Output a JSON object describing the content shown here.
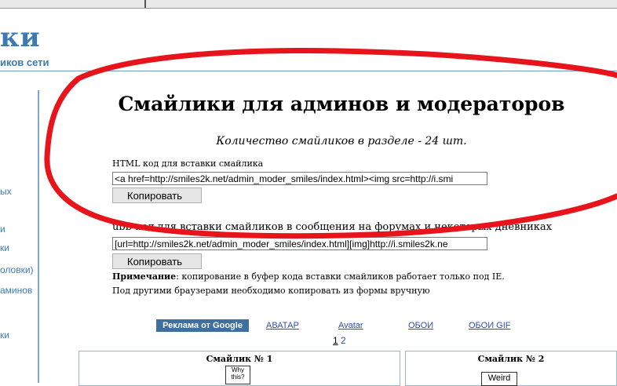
{
  "header": {
    "logo_fragment": "ки",
    "tagline_fragment": "иков сети"
  },
  "sidebar": {
    "items": [
      "ых",
      "и",
      "ки",
      "оловки)",
      "аминов",
      "ки"
    ]
  },
  "main": {
    "title": "Смайлики для админов и модераторов",
    "count_line": "Количество смайликов в разделе - 24 шт.",
    "html_label": "HTML код для вставки смайлика",
    "html_code": "<a href=http://smiles2k.net/admin_moder_smiles/index.html><img src=http://i.smi",
    "copy_button": "Копировать",
    "ubb_label": "ubb-код для вставки смайликов в сообщения на форумах и некоторых дневниках",
    "ubb_code": "[url=http://smiles2k.net/admin_moder_smiles/index.html][img]http://i.smiles2k.ne",
    "note_bold": "Примечание",
    "note_rest": ": копирование в буфер кода вставки смайликов работает только под IE.",
    "note_line2": "Под другими браузерами необходимо копировать из формы вручную"
  },
  "ads": {
    "google_label": "Реклама от Google",
    "links": [
      "АВАТАР",
      "Avatar",
      "ОБОИ",
      "ОБОИ GIF"
    ]
  },
  "pager": {
    "current": "1",
    "other": "2"
  },
  "smiles": [
    {
      "title": "Смайлик № 1",
      "sign_text": "Why this?"
    },
    {
      "title": "Смайлик № 2",
      "sign_text": "Weird"
    }
  ],
  "colors": {
    "accent": "#3d79b8",
    "annotation": "#e8141c",
    "ad_bg": "#3f6f9e"
  }
}
